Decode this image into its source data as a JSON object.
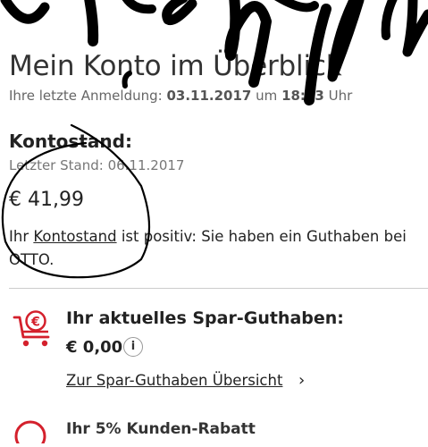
{
  "header": {
    "title": "Mein Konto im Überblick",
    "last_login_label": "Ihre letzte Anmeldung:",
    "last_login_date": "03.11.2017",
    "last_login_sep": "um",
    "last_login_time": "18:53",
    "last_login_suffix": "Uhr"
  },
  "kontostand": {
    "heading": "Kontostand:",
    "last_state": "Letzter Stand: 06.11.2017",
    "amount": "€ 41,99",
    "text_prefix": "Ihr",
    "text_link": "Kontostand",
    "text_suffix": "ist positiv: Sie haben ein Guthaben bei OTTO."
  },
  "spar": {
    "icon": "euro-cart-icon",
    "heading": "Ihr aktuelles Spar-Guthaben:",
    "amount": "€ 0,00",
    "info_glyph": "i",
    "link": "Zur Spar-Guthaben Übersicht",
    "chevron": "›"
  },
  "next_section": {
    "icon": "discount-icon",
    "text": "Ihr 5% Kunden-Rabatt"
  },
  "colors": {
    "accent": "#d4202c",
    "text": "#222222",
    "muted": "#666666",
    "divider": "#cccccc",
    "scribble": "#000000"
  }
}
